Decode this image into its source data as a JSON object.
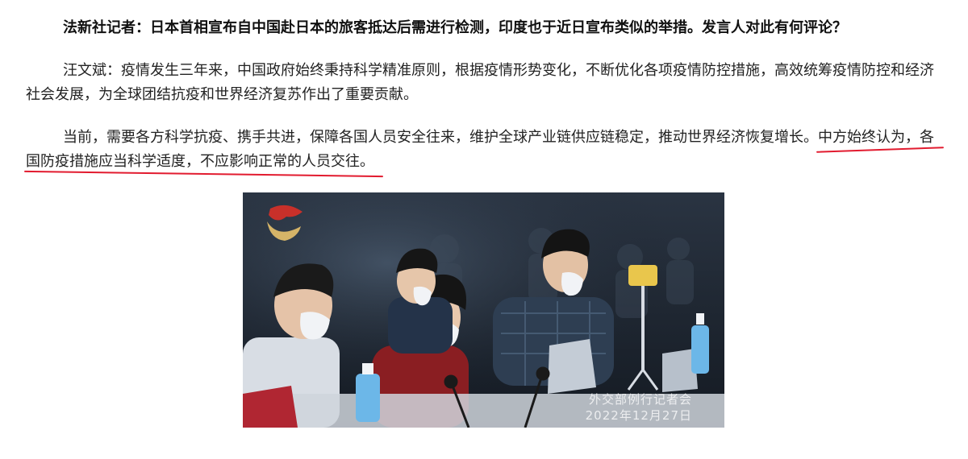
{
  "article": {
    "question": "法新社记者：日本首相宣布自中国赴日本的旅客抵达后需进行检测，印度也于近日宣布类似的举措。发言人对此有何评论？",
    "answer": "汪文斌：疫情发生三年来，中国政府始终秉持科学精准原则，根据疫情形势变化，不断优化各项疫情防控措施，高效统筹疫情防控和经济社会发展，为全球团结抗疫和世界经济复苏作出了重要贡献。",
    "statement_plain": "当前，需要各方科学抗疫、携手共进，保障各国人员安全往来，维护全球产业链供应链稳定，推动世界经济恢复增长。",
    "statement_highlight": "中方始终认为，各国防疫措施应当科学适度，不应影响正常的人员交往。"
  },
  "photo": {
    "caption_line1": "外交部例行记者会",
    "caption_line2": "2022年12月27日"
  },
  "colors": {
    "underline": "#e21b2f",
    "text": "#222222"
  }
}
